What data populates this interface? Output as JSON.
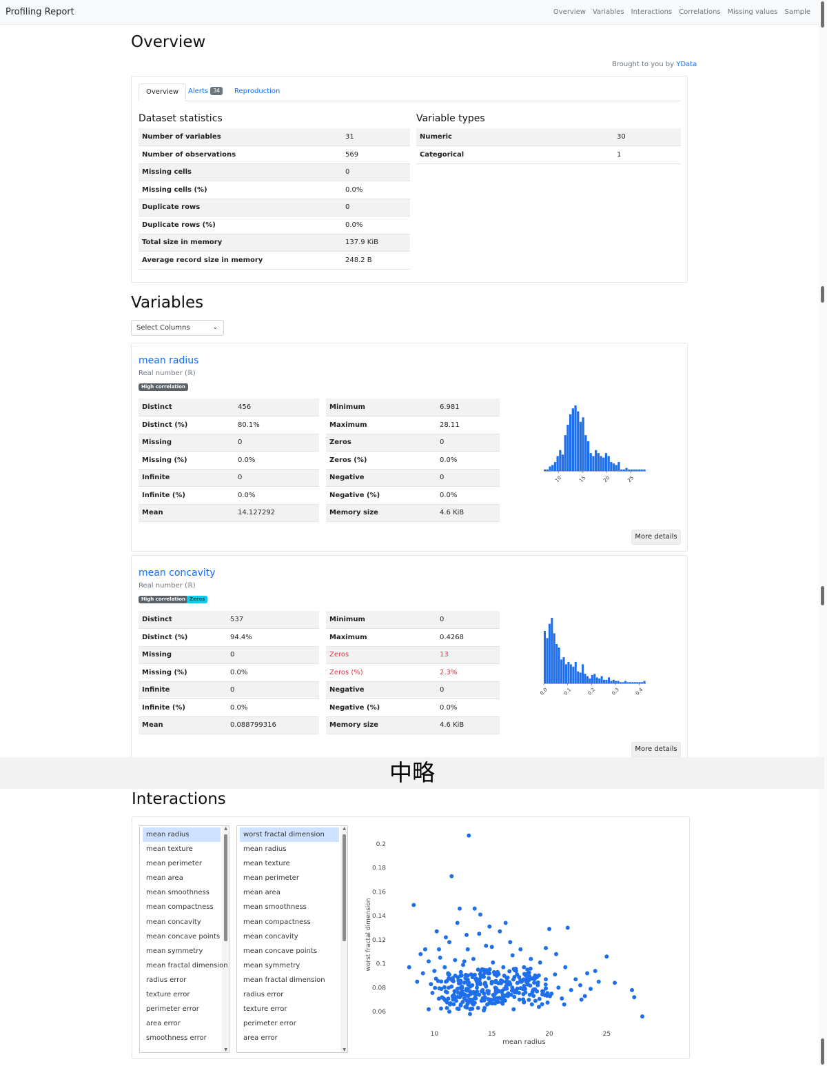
{
  "navbar": {
    "brand": "Profiling Report",
    "links": [
      "Overview",
      "Variables",
      "Interactions",
      "Correlations",
      "Missing values",
      "Sample"
    ]
  },
  "overview": {
    "title": "Overview",
    "brought_prefix": "Brought to you by",
    "brought_link": "YData",
    "tabs": {
      "overview": "Overview",
      "alerts": "Alerts",
      "alerts_count": "34",
      "reproduction": "Reproduction"
    },
    "dataset_title": "Dataset statistics",
    "dataset_rows": [
      [
        "Number of variables",
        "31"
      ],
      [
        "Number of observations",
        "569"
      ],
      [
        "Missing cells",
        "0"
      ],
      [
        "Missing cells (%)",
        "0.0%"
      ],
      [
        "Duplicate rows",
        "0"
      ],
      [
        "Duplicate rows (%)",
        "0.0%"
      ],
      [
        "Total size in memory",
        "137.9 KiB"
      ],
      [
        "Average record size in memory",
        "248.2 B"
      ]
    ],
    "types_title": "Variable types",
    "types_rows": [
      [
        "Numeric",
        "30"
      ],
      [
        "Categorical",
        "1"
      ]
    ]
  },
  "variables": {
    "title": "Variables",
    "select_label": "Select Columns",
    "more_details": "More details",
    "items": [
      {
        "name": "mean radius",
        "type": "Real number (ℝ)",
        "badges": [
          "High correlation"
        ],
        "left_rows": [
          [
            "Distinct",
            "456"
          ],
          [
            "Distinct (%)",
            "80.1%"
          ],
          [
            "Missing",
            "0"
          ],
          [
            "Missing (%)",
            "0.0%"
          ],
          [
            "Infinite",
            "0"
          ],
          [
            "Infinite (%)",
            "0.0%"
          ],
          [
            "Mean",
            "14.127292"
          ]
        ],
        "right_rows": [
          [
            "Minimum",
            "6.981"
          ],
          [
            "Maximum",
            "28.11"
          ],
          [
            "Zeros",
            "0"
          ],
          [
            "Zeros (%)",
            "0.0%"
          ],
          [
            "Negative",
            "0"
          ],
          [
            "Negative (%)",
            "0.0%"
          ],
          [
            "Memory size",
            "4.6 KiB"
          ]
        ],
        "alert_rows": [],
        "hist": {
          "xmin": 6.981,
          "xmax": 28.11,
          "ticks": [
            "10",
            "15",
            "20",
            "25"
          ],
          "tick_values": [
            10,
            15,
            20,
            25
          ],
          "counts": [
            1,
            1,
            3,
            4,
            6,
            10,
            14,
            11,
            24,
            31,
            38,
            42,
            44,
            40,
            33,
            36,
            24,
            20,
            12,
            10,
            14,
            12,
            10,
            9,
            12,
            10,
            6,
            5,
            4,
            6,
            1,
            1,
            2,
            1,
            1,
            1,
            1,
            1,
            1,
            1
          ]
        }
      },
      {
        "name": "mean concavity",
        "type": "Real number (ℝ)",
        "badges": [
          "High correlation",
          "Zeros"
        ],
        "left_rows": [
          [
            "Distinct",
            "537"
          ],
          [
            "Distinct (%)",
            "94.4%"
          ],
          [
            "Missing",
            "0"
          ],
          [
            "Missing (%)",
            "0.0%"
          ],
          [
            "Infinite",
            "0"
          ],
          [
            "Infinite (%)",
            "0.0%"
          ],
          [
            "Mean",
            "0.088799316"
          ]
        ],
        "right_rows": [
          [
            "Minimum",
            "0"
          ],
          [
            "Maximum",
            "0.4268"
          ],
          [
            "Zeros",
            "13"
          ],
          [
            "Zeros (%)",
            "2.3%"
          ],
          [
            "Negative",
            "0"
          ],
          [
            "Negative (%)",
            "0.0%"
          ],
          [
            "Memory size",
            "4.6 KiB"
          ]
        ],
        "alert_rows": [
          2,
          3
        ],
        "hist": {
          "xmin": 0,
          "xmax": 0.4268,
          "ticks": [
            "0.0",
            "0.1",
            "0.2",
            "0.3",
            "0.4"
          ],
          "tick_values": [
            0,
            0.1,
            0.2,
            0.3,
            0.4
          ],
          "counts": [
            44,
            38,
            50,
            55,
            42,
            33,
            30,
            20,
            22,
            16,
            18,
            16,
            14,
            18,
            10,
            9,
            16,
            8,
            6,
            4,
            7,
            8,
            5,
            4,
            6,
            3,
            3,
            5,
            2,
            3,
            2,
            2,
            1,
            1,
            2,
            1,
            1,
            1,
            1,
            1,
            1,
            1,
            2
          ]
        }
      }
    ]
  },
  "omitted_text": "中略",
  "interactions": {
    "title": "Interactions",
    "x_list": [
      "mean radius",
      "mean texture",
      "mean perimeter",
      "mean area",
      "mean smoothness",
      "mean compactness",
      "mean concavity",
      "mean concave points",
      "mean symmetry",
      "mean fractal dimension",
      "radius error",
      "texture error",
      "perimeter error",
      "area error",
      "smoothness error"
    ],
    "y_list": [
      "worst fractal dimension",
      "mean radius",
      "mean texture",
      "mean perimeter",
      "mean area",
      "mean smoothness",
      "mean compactness",
      "mean concavity",
      "mean concave points",
      "mean symmetry",
      "mean fractal dimension",
      "radius error",
      "texture error",
      "perimeter error",
      "area error"
    ],
    "selected_x": "mean radius",
    "selected_y": "worst fractal dimension",
    "chart_data": {
      "type": "scatter",
      "xlabel": "mean radius",
      "ylabel": "worst fractal dimension",
      "xlim": [
        6.5,
        29.0
      ],
      "ylim": [
        0.048,
        0.212
      ],
      "x_ticks": [
        10,
        15,
        20,
        25
      ],
      "y_ticks": [
        0.06,
        0.08,
        0.1,
        0.12,
        0.14,
        0.16,
        0.18,
        0.2
      ],
      "color": "#1f6feb",
      "points": [
        [
          13.0,
          0.207
        ],
        [
          11.5,
          0.173
        ],
        [
          8.2,
          0.149
        ],
        [
          7.8,
          0.097
        ],
        [
          8.5,
          0.085
        ],
        [
          8.8,
          0.108
        ],
        [
          9.0,
          0.092
        ],
        [
          9.5,
          0.102
        ],
        [
          9.7,
          0.083
        ],
        [
          10.0,
          0.094
        ],
        [
          10.2,
          0.127
        ],
        [
          10.4,
          0.112
        ],
        [
          10.6,
          0.079
        ],
        [
          10.8,
          0.071
        ],
        [
          10.9,
          0.097
        ],
        [
          11.0,
          0.085
        ],
        [
          11.1,
          0.076
        ],
        [
          11.2,
          0.092
        ],
        [
          11.3,
          0.118
        ],
        [
          11.4,
          0.067
        ],
        [
          11.5,
          0.081
        ],
        [
          11.6,
          0.088
        ],
        [
          11.7,
          0.074
        ],
        [
          11.8,
          0.103
        ],
        [
          11.9,
          0.069
        ],
        [
          12.0,
          0.079
        ],
        [
          12.0,
          0.134
        ],
        [
          12.1,
          0.086
        ],
        [
          12.2,
          0.072
        ],
        [
          12.3,
          0.093
        ],
        [
          12.3,
          0.066
        ],
        [
          12.4,
          0.081
        ],
        [
          12.5,
          0.099
        ],
        [
          12.5,
          0.075
        ],
        [
          12.6,
          0.071
        ],
        [
          12.7,
          0.088
        ],
        [
          12.7,
          0.064
        ],
        [
          12.8,
          0.079
        ],
        [
          12.9,
          0.112
        ],
        [
          12.9,
          0.073
        ],
        [
          13.0,
          0.084
        ],
        [
          13.0,
          0.068
        ],
        [
          13.1,
          0.077
        ],
        [
          13.2,
          0.091
        ],
        [
          13.2,
          0.07
        ],
        [
          13.3,
          0.082
        ],
        [
          13.4,
          0.066
        ],
        [
          13.4,
          0.104
        ],
        [
          13.5,
          0.075
        ],
        [
          13.6,
          0.087
        ],
        [
          13.6,
          0.071
        ],
        [
          13.7,
          0.08
        ],
        [
          13.8,
          0.063
        ],
        [
          13.8,
          0.095
        ],
        [
          13.9,
          0.074
        ],
        [
          14.0,
          0.141
        ],
        [
          14.0,
          0.083
        ],
        [
          14.1,
          0.069
        ],
        [
          14.2,
          0.078
        ],
        [
          14.3,
          0.089
        ],
        [
          14.4,
          0.072
        ],
        [
          14.5,
          0.115
        ],
        [
          14.5,
          0.081
        ],
        [
          14.6,
          0.066
        ],
        [
          14.7,
          0.076
        ],
        [
          14.8,
          0.092
        ],
        [
          14.9,
          0.07
        ],
        [
          15.0,
          0.085
        ],
        [
          15.1,
          0.101
        ],
        [
          15.2,
          0.074
        ],
        [
          15.3,
          0.08
        ],
        [
          15.4,
          0.068
        ],
        [
          15.5,
          0.093
        ],
        [
          15.6,
          0.077
        ],
        [
          15.8,
          0.086
        ],
        [
          15.9,
          0.071
        ],
        [
          16.0,
          0.097
        ],
        [
          16.1,
          0.079
        ],
        [
          16.3,
          0.088
        ],
        [
          16.4,
          0.073
        ],
        [
          16.6,
          0.083
        ],
        [
          16.8,
          0.107
        ],
        [
          17.0,
          0.076
        ],
        [
          17.2,
          0.091
        ],
        [
          17.4,
          0.07
        ],
        [
          17.6,
          0.085
        ],
        [
          17.9,
          0.079
        ],
        [
          18.1,
          0.095
        ],
        [
          18.3,
          0.074
        ],
        [
          18.6,
          0.088
        ],
        [
          18.8,
          0.069
        ],
        [
          19.0,
          0.082
        ],
        [
          19.2,
          0.101
        ],
        [
          19.4,
          0.077
        ],
        [
          19.7,
          0.087
        ],
        [
          20.0,
          0.129
        ],
        [
          20.2,
          0.075
        ],
        [
          20.5,
          0.091
        ],
        [
          20.8,
          0.08
        ],
        [
          21.1,
          0.071
        ],
        [
          21.4,
          0.097
        ],
        [
          21.6,
          0.13
        ],
        [
          21.9,
          0.078
        ],
        [
          22.3,
          0.087
        ],
        [
          22.8,
          0.07
        ],
        [
          23.3,
          0.092
        ],
        [
          23.6,
          0.079
        ],
        [
          24.0,
          0.094
        ],
        [
          24.3,
          0.085
        ],
        [
          25.0,
          0.106
        ],
        [
          25.7,
          0.084
        ],
        [
          27.2,
          0.078
        ],
        [
          27.4,
          0.072
        ],
        [
          28.1,
          0.056
        ],
        [
          12.2,
          0.146
        ],
        [
          13.5,
          0.146
        ],
        [
          14.8,
          0.131
        ],
        [
          16.6,
          0.118
        ],
        [
          17.5,
          0.112
        ],
        [
          19.7,
          0.113
        ],
        [
          11.0,
          0.122
        ],
        [
          12.8,
          0.124
        ],
        [
          15.7,
          0.127
        ],
        [
          18.4,
          0.104
        ],
        [
          10.5,
          0.105
        ],
        [
          9.2,
          0.112
        ],
        [
          20.6,
          0.108
        ],
        [
          22.7,
          0.082
        ],
        [
          11.3,
          0.06
        ],
        [
          13.1,
          0.058
        ],
        [
          14.3,
          0.061
        ],
        [
          16.9,
          0.062
        ],
        [
          19.1,
          0.064
        ],
        [
          21.3,
          0.066
        ],
        [
          23.1,
          0.073
        ],
        [
          12.6,
          0.102
        ],
        [
          15.0,
          0.114
        ],
        [
          17.8,
          0.097
        ],
        [
          13.9,
          0.125
        ],
        [
          16.2,
          0.134
        ]
      ]
    }
  }
}
